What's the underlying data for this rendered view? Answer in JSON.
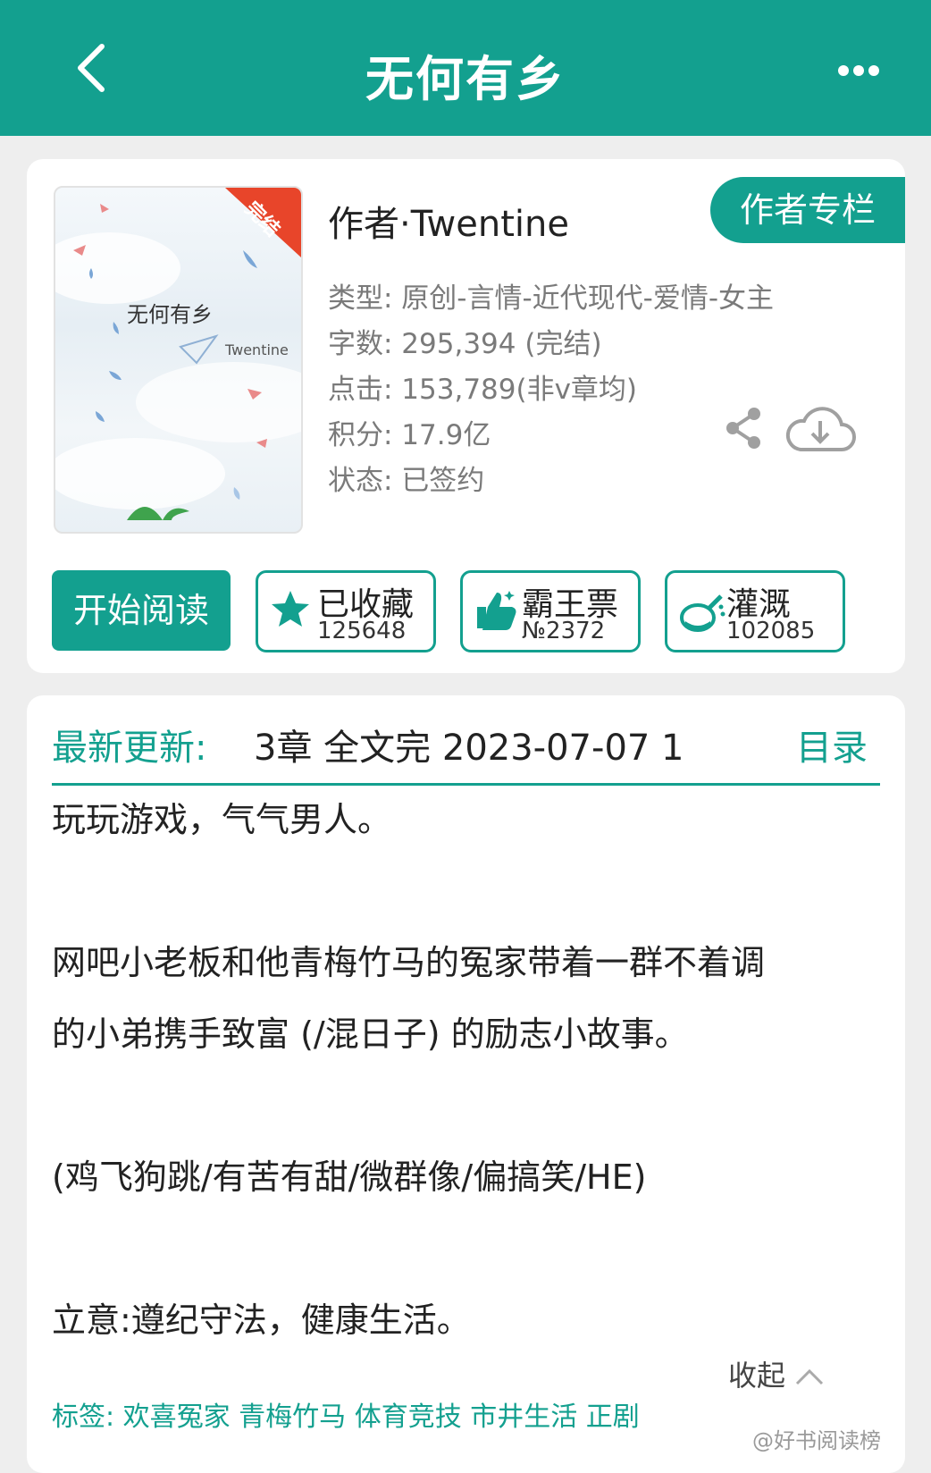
{
  "header": {
    "title": "无何有乡",
    "back_icon": "chevron-left-icon",
    "more_icon": "more-dots-icon"
  },
  "book": {
    "cover_title": "无何有乡",
    "cover_author": "Twentine",
    "cover_badge": "完结",
    "author_line": "作者·Twentine",
    "author_column_button": "作者专栏",
    "meta": [
      "类型: 原创-言情-近代现代-爱情-女主",
      "字数: 295,394 (完结)",
      "点击: 153,789(非v章均)",
      "积分: 17.9亿",
      "状态: 已签约"
    ]
  },
  "actions": {
    "read_button": "开始阅读",
    "favorite": {
      "label": "已收藏",
      "count": "125648"
    },
    "bawang": {
      "label": "霸王票",
      "count": "№2372"
    },
    "water": {
      "label": "灌溉",
      "count": "102085"
    }
  },
  "latest": {
    "label": "最新更新:",
    "text": "3章  全文完  2023-07-07  1",
    "toc": "目录"
  },
  "description": [
    "玩玩游戏，气气男人。",
    "网吧小老板和他青梅竹马的冤家带着一群不着调",
    "的小弟携手致富 (/混日子) 的励志小故事。",
    "(鸡飞狗跳/有苦有甜/微群像/偏搞笑/HE)",
    "立意:遵纪守法，健康生活。"
  ],
  "collapse_label": "收起",
  "tags_line": "标签: 欢喜冤家 青梅竹马 体育竞技 市井生活 正剧",
  "watermark": "@好书阅读榜",
  "colors": {
    "accent": "#13a08f",
    "background": "#eeeeee"
  }
}
